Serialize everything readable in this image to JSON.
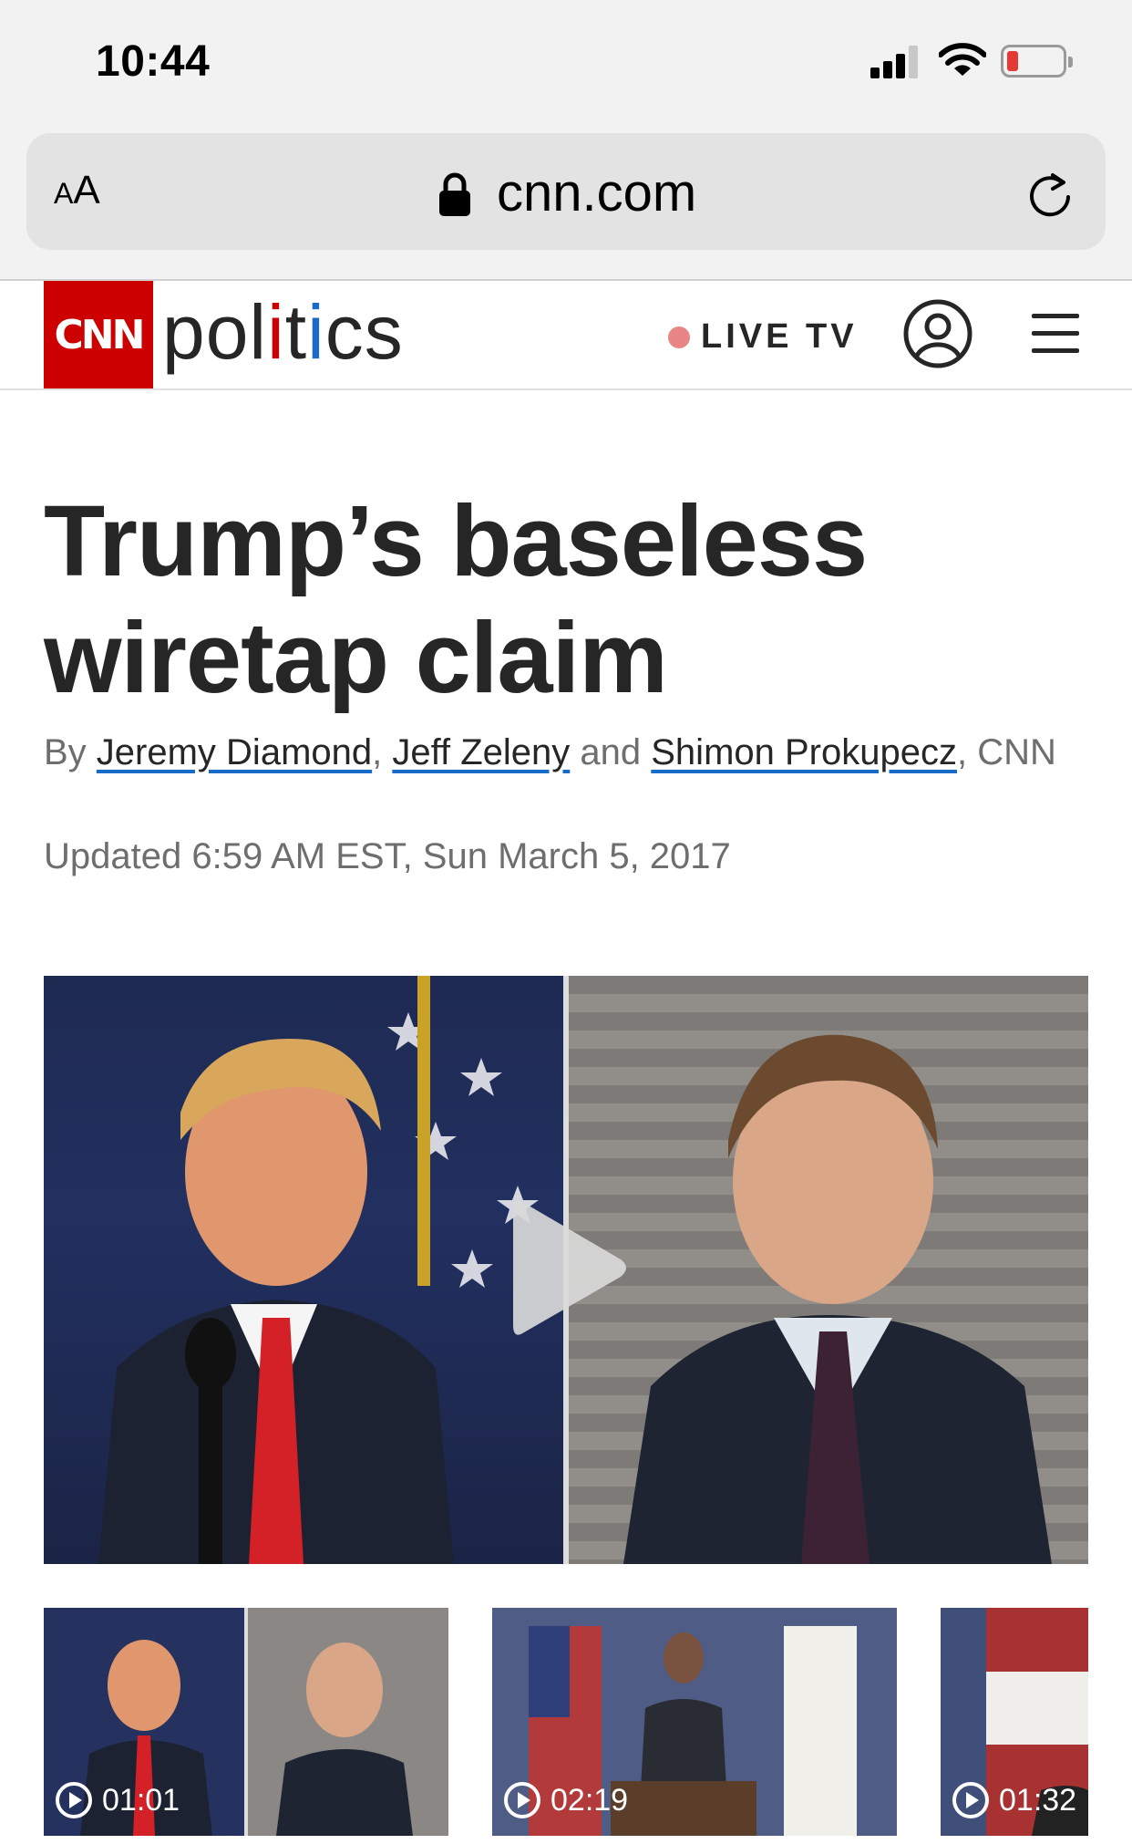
{
  "status_bar": {
    "time": "10:44"
  },
  "browser": {
    "text_size_label_small": "A",
    "text_size_label_large": "A",
    "domain": "cnn.com"
  },
  "site_header": {
    "logo_text": "CNN",
    "section_pre": "pol",
    "section_i": "i",
    "section_mid": "t",
    "section_i2": "i",
    "section_post": "cs",
    "live_label": "LIVE TV"
  },
  "article": {
    "headline": "Trump’s baseless wiretap claim",
    "byline_prefix": "By ",
    "authors": [
      "Jeremy Diamond",
      "Jeff Zeleny",
      "Shimon Prokupecz"
    ],
    "byline_sep": ", ",
    "byline_and": " and ",
    "byline_suffix": ", CNN",
    "updated": "Updated 6:59 AM EST, Sun March 5, 2017"
  },
  "thumbnails": [
    {
      "duration": "01:01"
    },
    {
      "duration": "02:19"
    },
    {
      "duration": "01:32"
    }
  ],
  "colors": {
    "brand_red": "#cc0000",
    "live_dot": "#e88585",
    "text_dark": "#262626",
    "text_muted": "#6e6e6e",
    "link_underline": "#1a6ac7"
  }
}
